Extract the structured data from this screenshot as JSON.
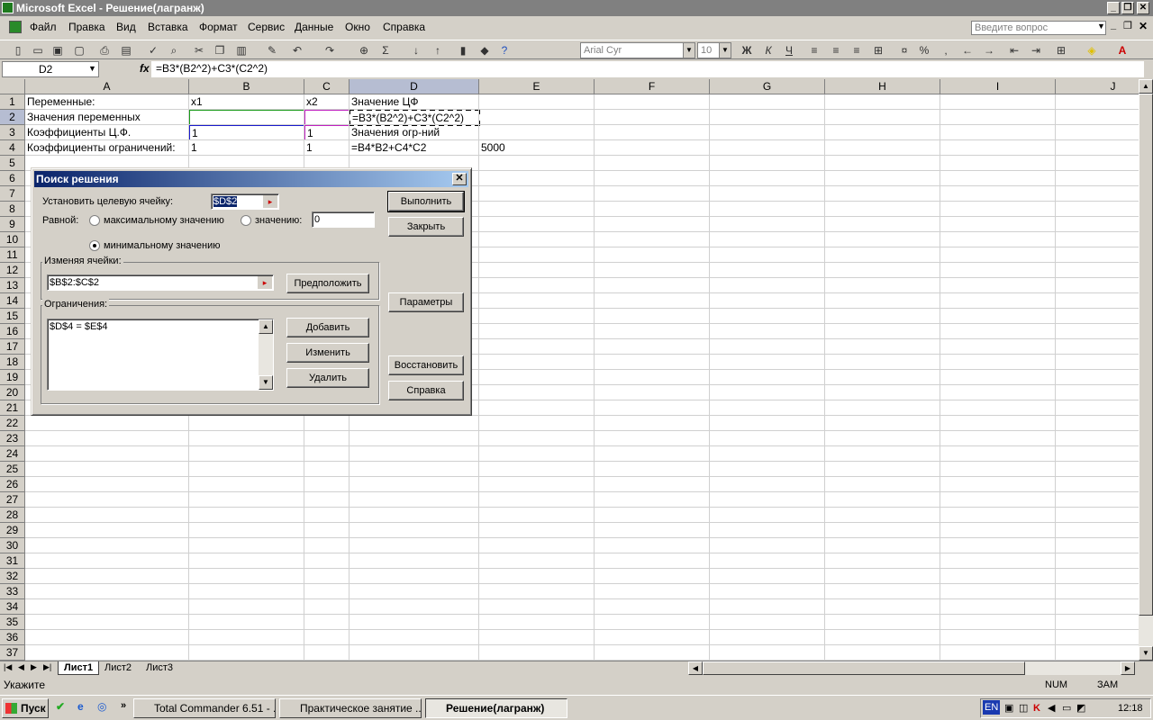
{
  "window": {
    "title": "Microsoft Excel - Решение(лагранж)"
  },
  "menu": {
    "items": [
      "Файл",
      "Правка",
      "Вид",
      "Вставка",
      "Формат",
      "Сервис",
      "Данные",
      "Окно",
      "Справка"
    ],
    "help_placeholder": "Введите вопрос"
  },
  "toolbar": {
    "font": "Arial Cyr",
    "size": "10",
    "percent": "%",
    "bold": "Ж",
    "italic": "К",
    "underline": "Ч",
    "sigma": "Σ"
  },
  "formula_bar": {
    "name_box": "D2",
    "fx": "fx",
    "formula": "=B3*(B2^2)+C3*(C2^2)"
  },
  "sheet": {
    "columns": [
      "A",
      "B",
      "C",
      "D",
      "E",
      "F",
      "G",
      "H",
      "I",
      "J"
    ],
    "rows": [
      "1",
      "2",
      "3",
      "4",
      "5",
      "6",
      "7",
      "8",
      "9",
      "10",
      "11",
      "12",
      "13",
      "14",
      "15",
      "16",
      "17",
      "18",
      "19",
      "20",
      "21",
      "22",
      "23",
      "24",
      "25",
      "26",
      "27",
      "28",
      "29",
      "30",
      "31",
      "32",
      "33",
      "34",
      "35",
      "36",
      "37"
    ],
    "cells": {
      "A1": "Переменные:",
      "B1": "x1",
      "C1": "x2",
      "D1": "Значение ЦФ",
      "A2": "Значения переменных",
      "D2": "=B3*(B2^2)+C3*(C2^2)",
      "A3": "Коэффициенты Ц.Ф.",
      "B3": "1",
      "C3": "1",
      "D3": "Значения огр-ний",
      "A4": "Коэффициенты ограничений:",
      "B4": "1",
      "C4": "1",
      "D4": "=B4*B2+C4*C2",
      "E4": "5000"
    },
    "tabs": [
      "Лист1",
      "Лист2",
      "Лист3"
    ]
  },
  "dialog": {
    "title": "Поиск решения",
    "target_label": "Установить целевую ячейку:",
    "target_value": "$D$2",
    "equal_label": "Равной:",
    "opt_max": "максимальному значению",
    "opt_value": "значению:",
    "value_field": "0",
    "opt_min": "минимальному значению",
    "changing_label": "Изменяя ячейки:",
    "changing_value": "$B$2:$C$2",
    "guess_button": "Предположить",
    "constraints_label": "Ограничения:",
    "constraints": [
      "$D$4 = $E$4"
    ],
    "add_button": "Добавить",
    "change_button": "Изменить",
    "delete_button": "Удалить",
    "solve_button": "Выполнить",
    "close_button": "Закрыть",
    "options_button": "Параметры",
    "reset_button": "Восстановить",
    "help_button": "Справка",
    "selected_option": "min"
  },
  "status": {
    "text": "Укажите",
    "num": "NUM",
    "zam": "ЗАМ"
  },
  "taskbar": {
    "start": "Пуск",
    "tasks": [
      "Total Commander 6.51 - ...",
      "Практическое занятие ...",
      "Решение(лагранж)"
    ],
    "lang": "EN",
    "time": "12:18"
  }
}
